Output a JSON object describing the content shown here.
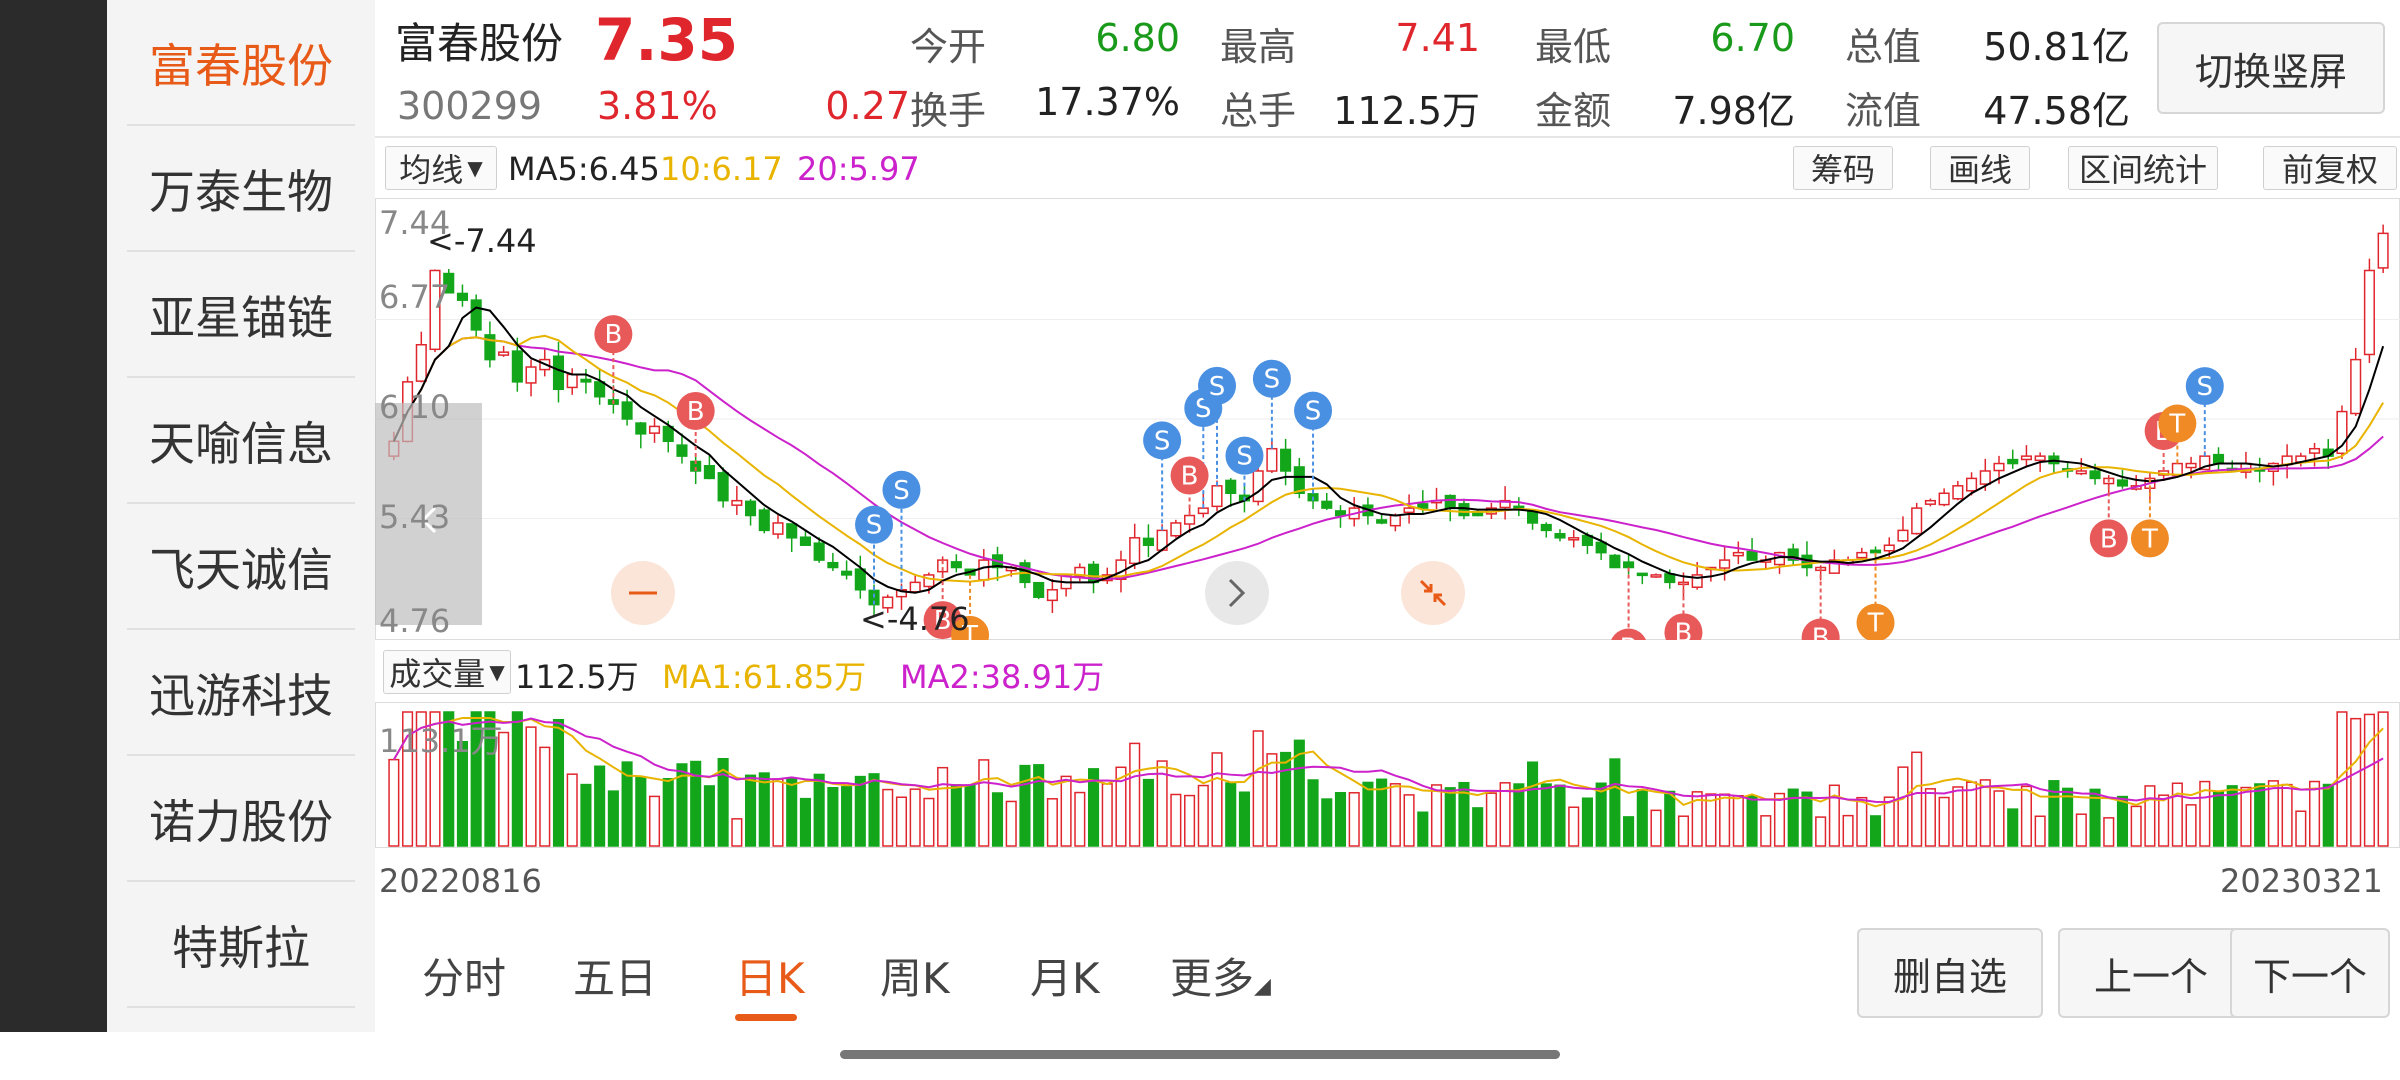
{
  "sidebar": {
    "stocks": [
      {
        "name": "富春股份",
        "active": true
      },
      {
        "name": "万泰生物",
        "active": false
      },
      {
        "name": "亚星锚链",
        "active": false
      },
      {
        "name": "天喻信息",
        "active": false
      },
      {
        "name": "飞天诚信",
        "active": false
      },
      {
        "name": "迅游科技",
        "active": false
      },
      {
        "name": "诺力股份",
        "active": false
      },
      {
        "name": "特斯拉",
        "active": false
      }
    ]
  },
  "quote": {
    "name": "富春股份",
    "price": "7.35",
    "code": "300299",
    "change_pct": "3.81%",
    "change": "0.27",
    "open_label": "今开",
    "open": "6.80",
    "high_label": "最高",
    "high": "7.41",
    "low_label": "最低",
    "low": "6.70",
    "mktcap_label": "总值",
    "mktcap": "50.81亿",
    "turnover_label": "换手",
    "turnover": "17.37%",
    "vol_label": "总手",
    "vol": "112.5万",
    "amount_label": "金额",
    "amount": "7.98亿",
    "float_label": "流值",
    "float": "47.58亿",
    "switch_label": "切换竖屏"
  },
  "kline_toolbar": {
    "ma_select": "均线",
    "ma5": "MA5:6.45",
    "ma10": "10:6.17",
    "ma20": "20:5.97",
    "buttons": [
      "筹码",
      "画线",
      "区间统计",
      "前复权"
    ]
  },
  "volume_toolbar": {
    "select": "成交量",
    "value": "112.5万",
    "ma1": "MA1:61.85万",
    "ma2": "MA2:38.91万",
    "max_label": "113.1万"
  },
  "chart_data": {
    "type": "candlestick",
    "y_ticks": [
      "7.44",
      "6.77",
      "6.10",
      "5.43",
      "4.76"
    ],
    "ylim": [
      4.76,
      7.44
    ],
    "max_annotation": "<-7.44",
    "min_annotation": "<-4.76",
    "x_start": "20220816",
    "x_end": "20230321",
    "close": [
      5.95,
      6.35,
      6.6,
      7.1,
      6.95,
      6.9,
      6.7,
      6.5,
      6.55,
      6.35,
      6.45,
      6.5,
      6.3,
      6.4,
      6.35,
      6.25,
      6.2,
      6.1,
      6.0,
      6.05,
      5.95,
      5.85,
      5.75,
      5.7,
      5.55,
      5.55,
      5.45,
      5.35,
      5.4,
      5.3,
      5.25,
      5.15,
      5.1,
      5.05,
      4.95,
      4.85,
      4.9,
      4.95,
      5.0,
      5.05,
      5.15,
      5.1,
      5.05,
      5.15,
      5.1,
      5.1,
      5.0,
      4.9,
      4.95,
      5.05,
      5.1,
      5.0,
      5.05,
      5.15,
      5.3,
      5.25,
      5.35,
      5.4,
      5.45,
      5.5,
      5.65,
      5.6,
      5.55,
      5.75,
      5.9,
      5.75,
      5.6,
      5.55,
      5.5,
      5.45,
      5.5,
      5.45,
      5.4,
      5.45,
      5.5,
      5.5,
      5.55,
      5.5,
      5.45,
      5.45,
      5.5,
      5.55,
      5.5,
      5.4,
      5.35,
      5.3,
      5.3,
      5.25,
      5.2,
      5.1,
      5.1,
      5.05,
      5.05,
      5.0,
      5.0,
      5.05,
      5.1,
      5.15,
      5.2,
      5.15,
      5.15,
      5.2,
      5.15,
      5.1,
      5.1,
      5.15,
      5.15,
      5.2,
      5.2,
      5.25,
      5.35,
      5.5,
      5.55,
      5.6,
      5.65,
      5.7,
      5.75,
      5.8,
      5.8,
      5.85,
      5.85,
      5.8,
      5.75,
      5.75,
      5.7,
      5.7,
      5.65,
      5.65,
      5.7,
      5.75,
      5.8,
      5.8,
      5.85,
      5.8,
      5.75,
      5.8,
      5.75,
      5.8,
      5.85,
      5.85,
      5.9,
      5.85,
      6.15,
      6.5,
      7.1,
      7.35
    ],
    "volume_ma1": "MA1",
    "volume_ma2": "MA2"
  },
  "chart_markers": {
    "S": "S",
    "B": "B",
    "T": "T"
  },
  "bottom_nav": {
    "tabs": [
      "分时",
      "五日",
      "日K",
      "周K",
      "月K",
      "更多"
    ],
    "active_tab": "日K",
    "actions": [
      "删自选",
      "上一个",
      "下一个"
    ]
  },
  "colors": {
    "up": "#e0262d",
    "down": "#13a61b",
    "ma5": "#000000",
    "ma10": "#e8b400",
    "ma20": "#cc22cc",
    "accent": "#e85a18"
  }
}
